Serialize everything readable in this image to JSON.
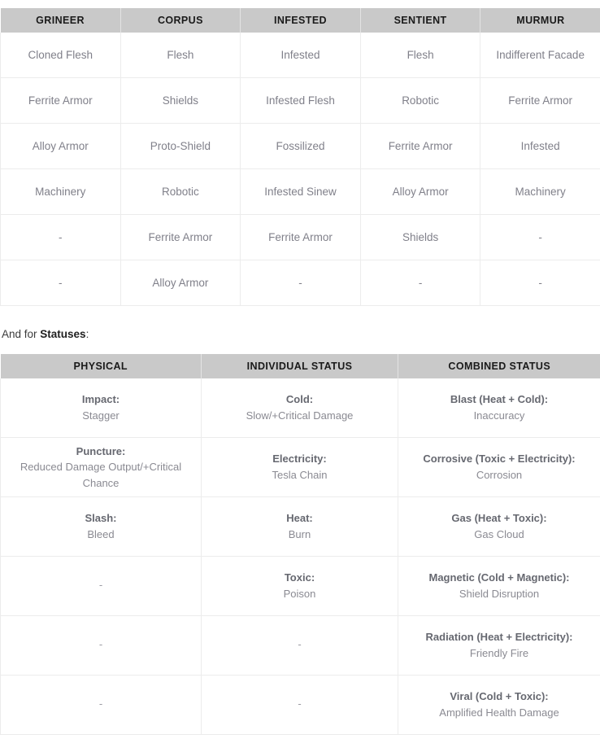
{
  "colors": {
    "header_bg": "#c9c9c9",
    "header_text": "#1a1a1a",
    "cell_text": "#80808a",
    "label_text": "#666870",
    "grid_line": "#ececec",
    "paragraph_text": "#3b3b3b"
  },
  "factions_table": {
    "name": "faction-health-types-table",
    "headers": [
      "GRINEER",
      "CORPUS",
      "INFESTED",
      "SENTIENT",
      "MURMUR"
    ],
    "rows": [
      [
        "Cloned Flesh",
        "Flesh",
        "Infested",
        "Flesh",
        "Indifferent Facade"
      ],
      [
        "Ferrite Armor",
        "Shields",
        "Infested Flesh",
        "Robotic",
        "Ferrite Armor"
      ],
      [
        "Alloy Armor",
        "Proto-Shield",
        "Fossilized",
        "Ferrite Armor",
        "Infested"
      ],
      [
        "Machinery",
        "Robotic",
        "Infested Sinew",
        "Alloy Armor",
        "Machinery"
      ],
      [
        "-",
        "Ferrite Armor",
        "Ferrite Armor",
        "Shields",
        "-"
      ],
      [
        "-",
        "Alloy Armor",
        "-",
        "-",
        "-"
      ]
    ]
  },
  "paragraph": {
    "before": "And for ",
    "emphasis": "Statuses",
    "after": ":"
  },
  "statuses_table": {
    "name": "status-effects-table",
    "headers": [
      "PHYSICAL",
      "INDIVIDUAL STATUS",
      "COMBINED STATUS"
    ],
    "rows": [
      [
        {
          "label": "Impact:",
          "value": "Stagger"
        },
        {
          "label": "Cold:",
          "value": "Slow/+Critical Damage"
        },
        {
          "label": "Blast (Heat + Cold):",
          "value": "Inaccuracy"
        }
      ],
      [
        {
          "label": "Puncture:",
          "value": "Reduced Damage Output/+Critical Chance"
        },
        {
          "label": "Electricity:",
          "value": "Tesla Chain"
        },
        {
          "label": "Corrosive (Toxic + Electricity):",
          "value": "Corrosion"
        }
      ],
      [
        {
          "label": "Slash:",
          "value": "Bleed"
        },
        {
          "label": "Heat:",
          "value": "Burn"
        },
        {
          "label": "Gas (Heat + Toxic):",
          "value": "Gas Cloud"
        }
      ],
      [
        {
          "label": "",
          "value": "",
          "dash": "-"
        },
        {
          "label": "Toxic:",
          "value": "Poison"
        },
        {
          "label": "Magnetic (Cold + Magnetic):",
          "value": "Shield Disruption"
        }
      ],
      [
        {
          "label": "",
          "value": "",
          "dash": "-"
        },
        {
          "label": "",
          "value": "",
          "dash": "-"
        },
        {
          "label": "Radiation (Heat + Electricity):",
          "value": "Friendly Fire"
        }
      ],
      [
        {
          "label": "",
          "value": "",
          "dash": "-"
        },
        {
          "label": "",
          "value": "",
          "dash": "-"
        },
        {
          "label": "Viral (Cold + Toxic):",
          "value": "Amplified Health Damage"
        }
      ]
    ]
  }
}
